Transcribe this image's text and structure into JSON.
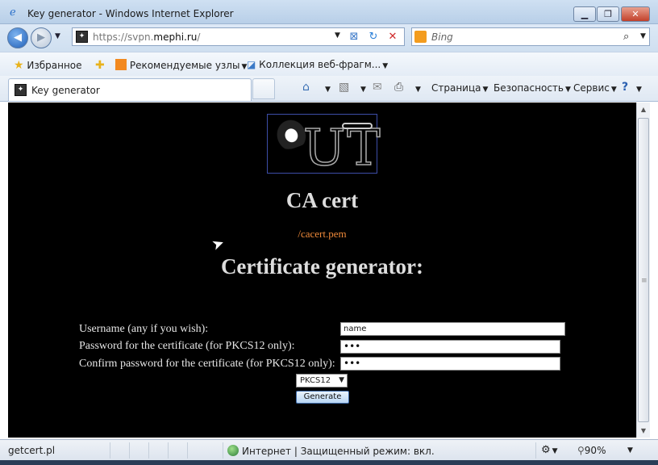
{
  "window": {
    "title": "Key generator - Windows Internet Explorer",
    "min_label": "▁",
    "max_label": "❐",
    "close_label": "✕"
  },
  "navbar": {
    "back_glyph": "◀",
    "forward_glyph": "▶",
    "address_prefix": "https://svpn.",
    "address_domain": "mephi.ru",
    "address_suffix": "/",
    "search_placeholder": "Bing",
    "search_glyph": "⌕"
  },
  "favorites": {
    "favorites_label": "Избранное",
    "suggested_sites": "Рекомендуемые узлы",
    "web_slice_gallery": "Коллекция веб-фрагм..."
  },
  "tab": {
    "label": "Key generator"
  },
  "command_bar": {
    "page_menu": "Страница",
    "safety_menu": "Безопасность",
    "tools_menu": "Сервис"
  },
  "page": {
    "logo_letters": "UT",
    "ca_title": "CA cert",
    "ca_link": "/cacert.pem",
    "generator_title": "Certificate generator:",
    "form": {
      "username_label": "Username (any if you wish):",
      "username_value": "name",
      "password_label": "Password for the certificate (for PKCS12 only):",
      "password_value": "•••",
      "confirm_label": "Confirm password for the certificate (for PKCS12 only):",
      "confirm_value": "•••",
      "format_value": "PKCS12",
      "generate_label": "Generate"
    }
  },
  "status_bar": {
    "status_text": "getcert.pl",
    "zone_text": "Интернет | Защищенный режим: вкл.",
    "zoom_text": "90%"
  }
}
